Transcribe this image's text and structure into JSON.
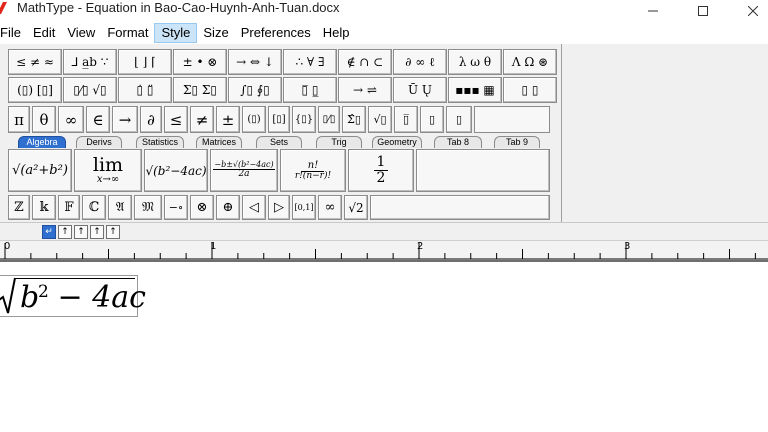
{
  "window": {
    "title": "MathType - Equation in Bao-Cao-Huynh-Anh-Tuan.docx",
    "accent": "#e1251b"
  },
  "menu": [
    "File",
    "Edit",
    "View",
    "Format",
    "Style",
    "Size",
    "Preferences",
    "Help"
  ],
  "menu_active": "Style",
  "palette_row1": [
    "≤ ≠ ≈",
    "⅃ a̲b ∵",
    "⌊ ⌋ ⌈",
    "± • ⊗",
    "→ ⇔ ↓",
    "∴ ∀ ∃",
    "∉ ∩ ⊂",
    "∂ ∞ ℓ",
    "λ ω θ",
    "Λ Ω ⊛"
  ],
  "palette_row2": [
    "(▯) [▯]",
    "▯⁄▯ √▯",
    "▯̇ ▯̈",
    "Σ▯ Σ▯",
    "∫▯ ∮▯",
    "▯̅ ▯̲",
    "→ ⇌",
    "Ū Ų",
    "▪▪▪ ▦",
    "▯ ▯"
  ],
  "symbols_row": [
    "π",
    "θ",
    "∞",
    "∈",
    "→",
    "∂",
    "≤",
    "≠",
    "±",
    "(▯)",
    "[▯]",
    "{▯}",
    "▯⁄▯",
    "Σ̂▯",
    "√▯",
    "▯̅",
    "▯",
    "▯"
  ],
  "tabs": [
    "Algebra",
    "Derivs",
    "Statistics",
    "Matrices",
    "Sets",
    "Trig",
    "Geometry",
    "Tab 8",
    "Tab 9"
  ],
  "active_tab": "Algebra",
  "templates": [
    "√(a²+b²)",
    "lim",
    "x→∞",
    "√(b²−4ac)",
    "−b±√(b²−4ac)",
    "2a",
    "n!",
    "r!(n−r)!",
    "1",
    "2"
  ],
  "small_row": [
    "ℤ",
    "𝕜",
    "𝔽",
    "ℂ",
    "𝔄",
    "𝔐",
    "−∘",
    "⊗",
    "⊕",
    "◁",
    "▷",
    "[0,1]",
    "∞",
    "√2"
  ],
  "tabstops": [
    "↵",
    "↑",
    "↑",
    "↑",
    "↑"
  ],
  "ruler": {
    "labels": [
      "0",
      "1",
      "2",
      "3"
    ]
  },
  "equation": {
    "text": "√b² − 4ac",
    "radicand_base": "b",
    "exponent": "2",
    "rest": " − 4ac"
  }
}
